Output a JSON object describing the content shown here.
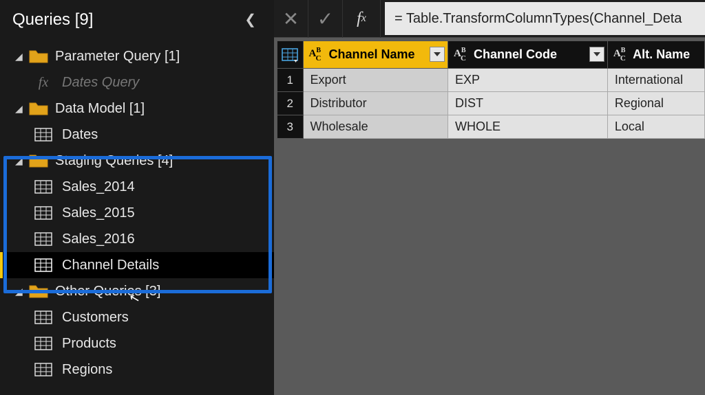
{
  "sidebar": {
    "title": "Queries [9]",
    "groups": [
      {
        "label": "Parameter Query [1]",
        "items": [
          {
            "label": "Dates Query",
            "type": "fx",
            "disabled": true
          }
        ]
      },
      {
        "label": "Data Model [1]",
        "items": [
          {
            "label": "Dates",
            "type": "table"
          }
        ]
      },
      {
        "label": "Staging Queries [4]",
        "items": [
          {
            "label": "Sales_2014",
            "type": "table"
          },
          {
            "label": "Sales_2015",
            "type": "table"
          },
          {
            "label": "Sales_2016",
            "type": "table"
          },
          {
            "label": "Channel Details",
            "type": "table",
            "selected": true
          }
        ]
      },
      {
        "label": "Other Queries [3]",
        "items": [
          {
            "label": "Customers",
            "type": "table"
          },
          {
            "label": "Products",
            "type": "table"
          },
          {
            "label": "Regions",
            "type": "table"
          }
        ]
      }
    ]
  },
  "formula": "= Table.TransformColumnTypes(Channel_Deta",
  "grid": {
    "columns": [
      {
        "name": "Channel Name",
        "type": "ABC",
        "selected": true
      },
      {
        "name": "Channel Code",
        "type": "ABC"
      },
      {
        "name": "Alt. Name",
        "type": "ABC"
      }
    ],
    "rows": [
      {
        "n": "1",
        "c0": "Export",
        "c1": "EXP",
        "c2": "International"
      },
      {
        "n": "2",
        "c0": "Distributor",
        "c1": "DIST",
        "c2": "Regional"
      },
      {
        "n": "3",
        "c0": "Wholesale",
        "c1": "WHOLE",
        "c2": "Local"
      }
    ]
  }
}
